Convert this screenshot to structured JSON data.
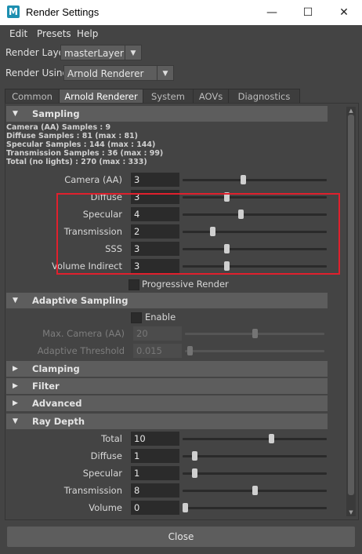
{
  "window": {
    "title": "Render Settings",
    "app_icon_letter": "M",
    "minimize": "—",
    "maximize": "☐",
    "close": "✕"
  },
  "menu": [
    "Edit",
    "Presets",
    "Help"
  ],
  "render_layer": {
    "label": "Render Layer",
    "value": "masterLayer"
  },
  "render_using": {
    "label": "Render Using",
    "value": "Arnold Renderer"
  },
  "tabs": [
    "Common",
    "Arnold Renderer",
    "System",
    "AOVs",
    "Diagnostics"
  ],
  "active_tab": "Arnold Renderer",
  "sampling": {
    "title": "Sampling",
    "info": [
      "Camera (AA) Samples : 9",
      "Diffuse Samples : 81 (max : 81)",
      "Specular Samples : 144 (max : 144)",
      "Transmission Samples : 36 (max : 99)",
      "Total (no lights) : 270 (max : 333)"
    ],
    "fields": [
      {
        "label": "Camera (AA)",
        "value": "3",
        "slider": 0.42
      },
      {
        "label": "Diffuse",
        "value": "3",
        "slider": 0.3
      },
      {
        "label": "Specular",
        "value": "4",
        "slider": 0.4
      },
      {
        "label": "Transmission",
        "value": "2",
        "slider": 0.2
      },
      {
        "label": "SSS",
        "value": "3",
        "slider": 0.3
      },
      {
        "label": "Volume Indirect",
        "value": "3",
        "slider": 0.3
      }
    ],
    "progressive_render": "Progressive Render"
  },
  "adaptive_sampling": {
    "title": "Adaptive Sampling",
    "enable": "Enable",
    "fields": [
      {
        "label": "Max. Camera (AA)",
        "value": "20",
        "slider": 0.5
      },
      {
        "label": "Adaptive Threshold",
        "value": "0.015",
        "slider": 0.02
      }
    ]
  },
  "collapsed_sections": [
    "Clamping",
    "Filter",
    "Advanced"
  ],
  "ray_depth": {
    "title": "Ray Depth",
    "fields": [
      {
        "label": "Total",
        "value": "10",
        "slider": 0.62
      },
      {
        "label": "Diffuse",
        "value": "1",
        "slider": 0.07
      },
      {
        "label": "Specular",
        "value": "1",
        "slider": 0.07
      },
      {
        "label": "Transmission",
        "value": "8",
        "slider": 0.5
      },
      {
        "label": "Volume",
        "value": "0",
        "slider": 0.0
      }
    ]
  },
  "close_button": "Close",
  "colors": {
    "highlight": "#e0202d",
    "background": "#444444",
    "section": "#5d5d5d"
  }
}
